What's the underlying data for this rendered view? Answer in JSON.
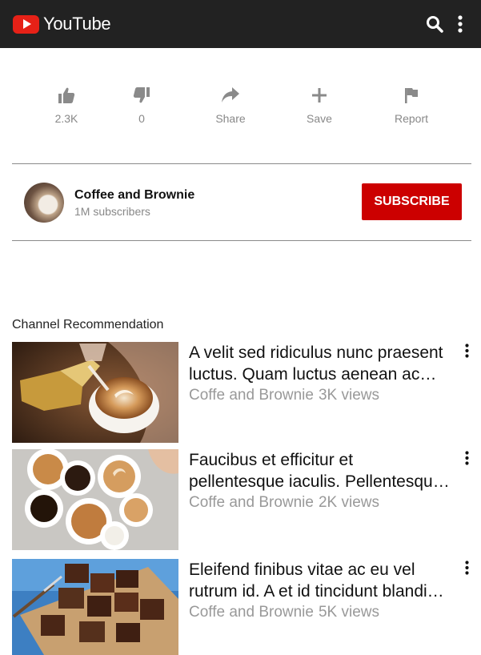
{
  "header": {
    "logo_text": "YouTube",
    "brand_color": "#e62117",
    "bar_color": "#222222",
    "search_icon": "search-icon",
    "menu_icon": "more-vertical-icon"
  },
  "actions": {
    "like": {
      "label": "2.3K",
      "icon": "thumbs-up-icon"
    },
    "dislike": {
      "label": "0",
      "icon": "thumbs-down-icon"
    },
    "share": {
      "label": "Share",
      "icon": "share-icon"
    },
    "save": {
      "label": "Save",
      "icon": "plus-icon"
    },
    "report": {
      "label": "Report",
      "icon": "flag-icon"
    }
  },
  "channel": {
    "name": "Coffee and Brownie",
    "subscribers": "1M subscribers",
    "subscribe_label": "SUBSCRIBE",
    "subscribe_color": "#cc0000"
  },
  "recommendations": {
    "title": "Channel Recommendation",
    "items": [
      {
        "title_line1": "A velit sed ridiculus nunc praesent",
        "title_line2": "luctus. Quam luctus aenean ac…",
        "channel": "Coffe and Brownie",
        "views": "3K views",
        "thumbnail": "latte-art-pour-image"
      },
      {
        "title_line1": "Faucibus et efficitur et",
        "title_line2": "pellentesque iaculis. Pellentesqu…",
        "channel": "Coffe and Brownie",
        "views": "2K views",
        "thumbnail": "coffee-cups-table-image"
      },
      {
        "title_line1": "Eleifend finibus vitae ac eu vel",
        "title_line2": "rutrum id. A et id tincidunt blandi…",
        "channel": "Coffe and Brownie",
        "views": "5K views",
        "thumbnail": "brownies-board-image"
      }
    ]
  }
}
